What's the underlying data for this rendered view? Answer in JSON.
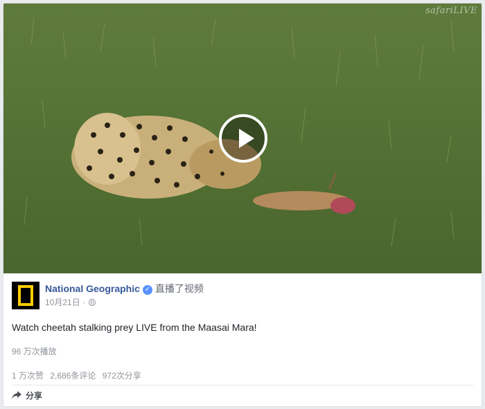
{
  "video": {
    "watermark": "safariLIVE",
    "play_icon": "play-icon"
  },
  "post": {
    "page_name": "National Geographic",
    "verified_icon": "verified-check-icon",
    "action": "直播了视频",
    "date": "10月21日",
    "separator": "·",
    "privacy_icon": "globe-icon",
    "text": "Watch cheetah stalking prey LIVE from the Maasai Mara!",
    "views": "96 万次播放",
    "reactions": "1 万次赞",
    "comments": "2,686条评论",
    "shares": "972次分享",
    "share_label": "分享"
  },
  "colors": {
    "link": "#365899",
    "muted": "#90949c",
    "brand_yellow": "#ffce00"
  }
}
